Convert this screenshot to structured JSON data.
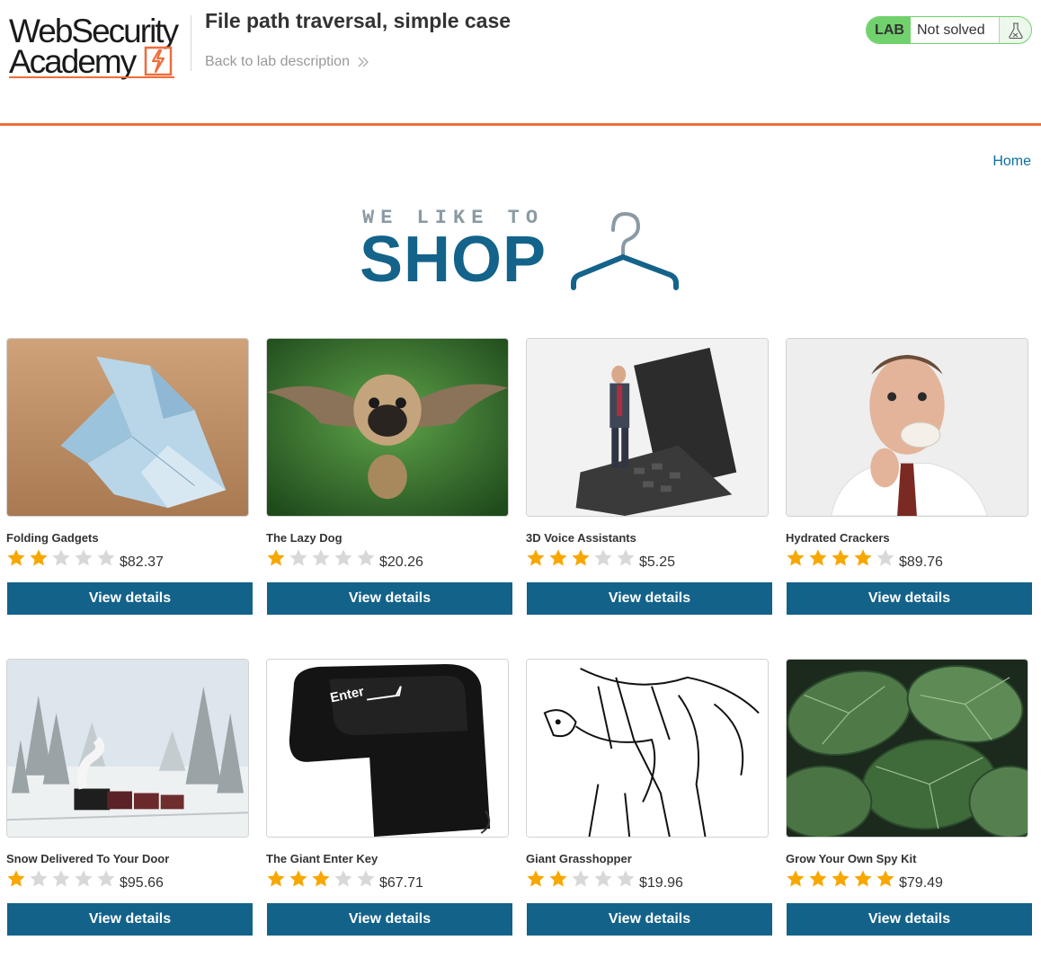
{
  "header": {
    "logo_line1": "WebSecurity",
    "logo_line2": "Academy",
    "lab_title": "File path traversal, simple case",
    "back_link": "Back to lab description",
    "lab_badge": "LAB",
    "lab_status": "Not solved",
    "lab_status_icon": "flask-icon"
  },
  "nav": {
    "home": "Home"
  },
  "banner": {
    "small": "WE LIKE TO",
    "big": "SHOP",
    "icon": "hanger-icon"
  },
  "colors": {
    "accent": "#ee6d3a",
    "button": "#13628a",
    "lab_green": "#70d16d",
    "star_filled": "#f7a700",
    "star_empty": "#d8d8d8",
    "link": "#0b6fa3"
  },
  "products": [
    {
      "name": "Folding Gadgets",
      "rating": 2,
      "max_rating": 5,
      "price": "$82.37",
      "button": "View details"
    },
    {
      "name": "The Lazy Dog",
      "rating": 1,
      "max_rating": 5,
      "price": "$20.26",
      "button": "View details"
    },
    {
      "name": "3D Voice Assistants",
      "rating": 3,
      "max_rating": 5,
      "price": "$5.25",
      "button": "View details"
    },
    {
      "name": "Hydrated Crackers",
      "rating": 4,
      "max_rating": 5,
      "price": "$89.76",
      "button": "View details"
    },
    {
      "name": "Snow Delivered To Your Door",
      "rating": 1,
      "max_rating": 5,
      "price": "$95.66",
      "button": "View details"
    },
    {
      "name": "The Giant Enter Key",
      "rating": 3,
      "max_rating": 5,
      "price": "$67.71",
      "button": "View details"
    },
    {
      "name": "Giant Grasshopper",
      "rating": 2,
      "max_rating": 5,
      "price": "$19.96",
      "button": "View details"
    },
    {
      "name": "Grow Your Own Spy Kit",
      "rating": 5,
      "max_rating": 5,
      "price": "$79.49",
      "button": "View details"
    }
  ],
  "product_image_labels": {
    "enter_key": "Enter"
  }
}
